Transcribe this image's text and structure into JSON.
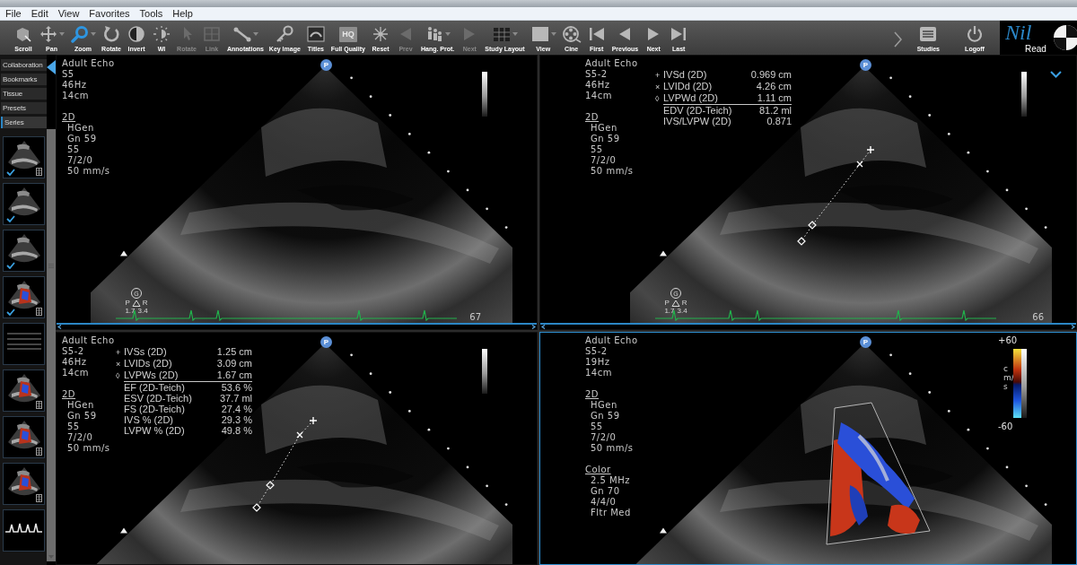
{
  "menu": [
    "File",
    "Edit",
    "View",
    "Favorites",
    "Tools",
    "Help"
  ],
  "toolbar": {
    "tools": [
      {
        "label": "Scroll",
        "selected": false,
        "disabled": false,
        "dropdown": false
      },
      {
        "label": "Pan",
        "selected": false,
        "disabled": false,
        "dropdown": true
      },
      {
        "label": "Zoom",
        "selected": true,
        "disabled": false,
        "dropdown": true
      },
      {
        "label": "Rotate",
        "selected": false,
        "disabled": false,
        "dropdown": false
      },
      {
        "label": "Invert",
        "selected": false,
        "disabled": false,
        "dropdown": false
      },
      {
        "label": "WI",
        "selected": false,
        "disabled": false,
        "dropdown": false
      },
      {
        "label": "Rotate",
        "selected": false,
        "disabled": true,
        "dropdown": false
      },
      {
        "label": "Link",
        "selected": false,
        "disabled": true,
        "dropdown": false
      },
      {
        "label": "Annotations",
        "selected": false,
        "disabled": false,
        "dropdown": true
      },
      {
        "label": "Key Image",
        "selected": false,
        "disabled": false,
        "dropdown": false
      },
      {
        "label": "Titles",
        "selected": false,
        "disabled": false,
        "dropdown": false
      },
      {
        "label": "Full Quality",
        "selected": false,
        "disabled": false,
        "dropdown": false,
        "icon_text": "HQ"
      },
      {
        "label": "Reset",
        "selected": false,
        "disabled": false,
        "dropdown": false
      },
      {
        "label": "Prev",
        "selected": false,
        "disabled": true,
        "dropdown": false
      },
      {
        "label": "Hang. Prot.",
        "selected": false,
        "disabled": false,
        "dropdown": true
      },
      {
        "label": "Next",
        "selected": false,
        "disabled": true,
        "dropdown": false
      },
      {
        "label": "Study Layout",
        "selected": false,
        "disabled": false,
        "dropdown": true
      },
      {
        "label": "View",
        "selected": false,
        "disabled": false,
        "dropdown": true
      },
      {
        "label": "Cine",
        "selected": false,
        "disabled": false,
        "dropdown": false
      },
      {
        "label": "First",
        "selected": false,
        "disabled": false,
        "dropdown": false
      },
      {
        "label": "Previous",
        "selected": false,
        "disabled": false,
        "dropdown": false
      },
      {
        "label": "Next",
        "selected": false,
        "disabled": false,
        "dropdown": false
      },
      {
        "label": "Last",
        "selected": false,
        "disabled": false,
        "dropdown": false
      }
    ],
    "right_tools": [
      {
        "label": "Studies"
      },
      {
        "label": "Logoff"
      }
    ]
  },
  "logo": {
    "script": "Nil",
    "word": "Read"
  },
  "sidebar": {
    "tabs": [
      {
        "label": "Collaboration",
        "selected": false
      },
      {
        "label": "Bookmarks",
        "selected": false
      },
      {
        "label": "Tissue",
        "selected": false
      },
      {
        "label": "Presets",
        "selected": false
      },
      {
        "label": "Series",
        "selected": true
      }
    ],
    "thumbnails": [
      {
        "kind": "bmode",
        "checked": true,
        "film_icon": true
      },
      {
        "kind": "bmode",
        "checked": true,
        "film_icon": false
      },
      {
        "kind": "bmode",
        "checked": true,
        "film_icon": false
      },
      {
        "kind": "doppler",
        "checked": true,
        "film_icon": true
      },
      {
        "kind": "mmode",
        "checked": false,
        "film_icon": false
      },
      {
        "kind": "doppler",
        "checked": false,
        "film_icon": true
      },
      {
        "kind": "doppler",
        "checked": false,
        "film_icon": true
      },
      {
        "kind": "doppler",
        "checked": false,
        "film_icon": true
      },
      {
        "kind": "waveform",
        "checked": false,
        "film_icon": false
      }
    ]
  },
  "viewports": [
    {
      "selected": false,
      "info": [
        "Adult Echo",
        "S5",
        "46Hz",
        "14cm"
      ],
      "sections": [
        {
          "heading": "2D",
          "lines": [
            "HGen",
            "Gn 59",
            "55",
            "7/2/0",
            "50 mm/s"
          ]
        }
      ],
      "probe_badge": "P",
      "orientation": {
        "badge": "G",
        "left": "P",
        "right": "R",
        "values": [
          "1.7",
          "3.4"
        ]
      },
      "frame": "67",
      "ecg_trace": true,
      "options_chevron": false,
      "color_flow": false
    },
    {
      "selected": false,
      "info": [
        "Adult Echo",
        "S5-2",
        "46Hz",
        "14cm"
      ],
      "sections": [
        {
          "heading": "2D",
          "lines": [
            "HGen",
            "Gn 59",
            "55",
            "7/2/0",
            "50 mm/s"
          ]
        }
      ],
      "measurements": {
        "measured": [
          {
            "marker": "+",
            "label": "IVSd (2D)",
            "value": "0.969 cm"
          },
          {
            "marker": "×",
            "label": "LVIDd (2D)",
            "value": "4.26 cm"
          },
          {
            "marker": "◊",
            "label": "LVPWd (2D)",
            "value": "1.11 cm"
          }
        ],
        "calculated": [
          {
            "label": "EDV (2D-Teich)",
            "value": "81.2 ml"
          },
          {
            "label": "IVS/LVPW (2D)",
            "value": "0.871"
          }
        ]
      },
      "probe_badge": "P",
      "orientation": {
        "badge": "G",
        "left": "P",
        "right": "R",
        "values": [
          "1.7",
          "3.4"
        ]
      },
      "frame": "66",
      "ecg_trace": true,
      "options_chevron": true,
      "color_flow": false
    },
    {
      "selected": false,
      "info": [
        "Adult Echo",
        "S5-2",
        "46Hz",
        "14cm"
      ],
      "sections": [
        {
          "heading": "2D",
          "lines": [
            "HGen",
            "Gn 59",
            "55",
            "7/2/0",
            "50 mm/s"
          ]
        }
      ],
      "measurements": {
        "measured": [
          {
            "marker": "+",
            "label": "IVSs (2D)",
            "value": "1.25 cm"
          },
          {
            "marker": "×",
            "label": "LVIDs (2D)",
            "value": "3.09 cm"
          },
          {
            "marker": "◊",
            "label": "LVPWs (2D)",
            "value": "1.67 cm"
          }
        ],
        "calculated": [
          {
            "label": "EF (2D-Teich)",
            "value": "53.6 %"
          },
          {
            "label": "ESV (2D-Teich)",
            "value": "37.7 ml"
          },
          {
            "label": "FS (2D-Teich)",
            "value": "27.4 %"
          },
          {
            "label": "IVS % (2D)",
            "value": "29.3 %"
          },
          {
            "label": "LVPW % (2D)",
            "value": "49.8 %"
          }
        ]
      },
      "probe_badge": "P",
      "ecg_trace": false,
      "options_chevron": false,
      "color_flow": false
    },
    {
      "selected": true,
      "info": [
        "Adult Echo",
        "S5-2",
        "19Hz",
        "14cm"
      ],
      "sections": [
        {
          "heading": "2D",
          "lines": [
            "HGen",
            "Gn 59",
            "55",
            "7/2/0",
            "50 mm/s"
          ]
        },
        {
          "heading": "Color",
          "lines": [
            "2.5 MHz",
            "Gn 70",
            "4/4/0",
            "Fltr Med"
          ]
        }
      ],
      "probe_badge": "P",
      "color_scale": {
        "max": "+60",
        "unit": "cm/s",
        "min": "-60"
      },
      "ecg_trace": false,
      "options_chevron": false,
      "color_flow": true
    }
  ]
}
